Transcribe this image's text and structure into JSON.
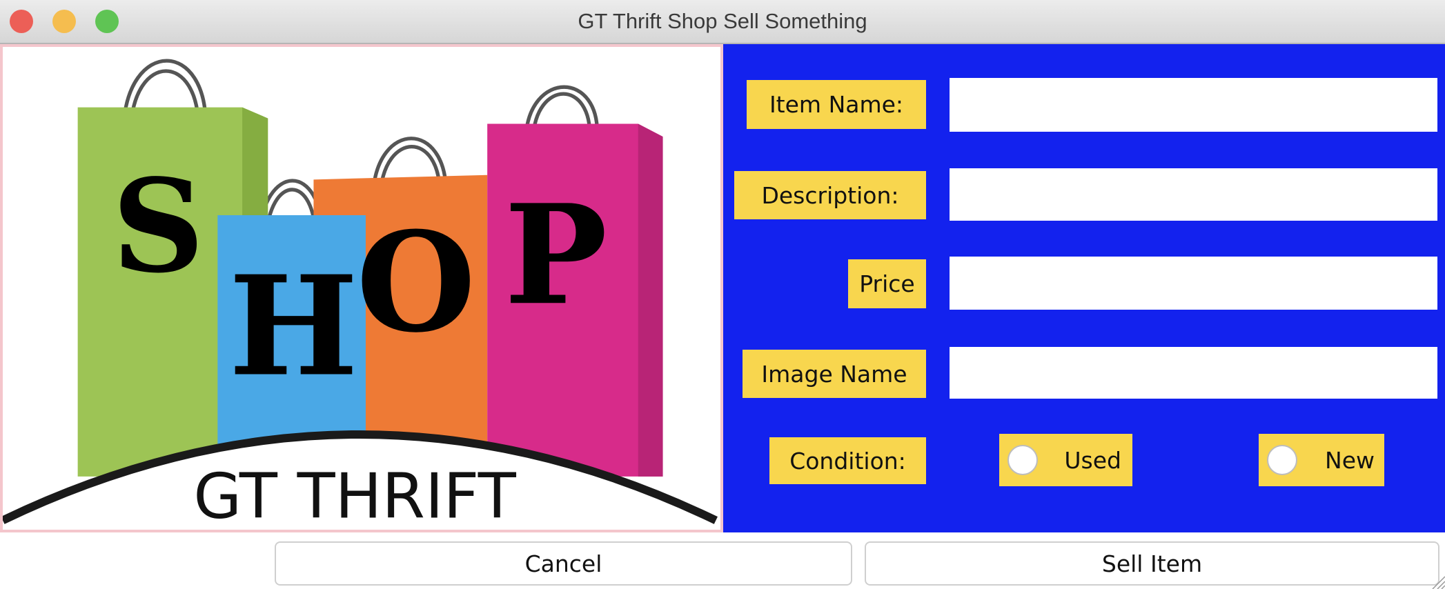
{
  "window": {
    "title": "GT Thrift Shop Sell Something"
  },
  "logo": {
    "letters": [
      "S",
      "H",
      "O",
      "P"
    ],
    "caption": "GT THRIFT"
  },
  "form": {
    "item_name": {
      "label": "Item Name:",
      "value": ""
    },
    "description": {
      "label": "Description:",
      "value": ""
    },
    "price": {
      "label": "Price",
      "value": ""
    },
    "image_name": {
      "label": "Image Name",
      "value": ""
    },
    "condition": {
      "label": "Condition:",
      "options": [
        "Used",
        "New"
      ],
      "selected": null
    }
  },
  "buttons": {
    "cancel": "Cancel",
    "sell": "Sell Item"
  },
  "colors": {
    "panel": "#1322ee",
    "label_bg": "#f8d64e"
  }
}
